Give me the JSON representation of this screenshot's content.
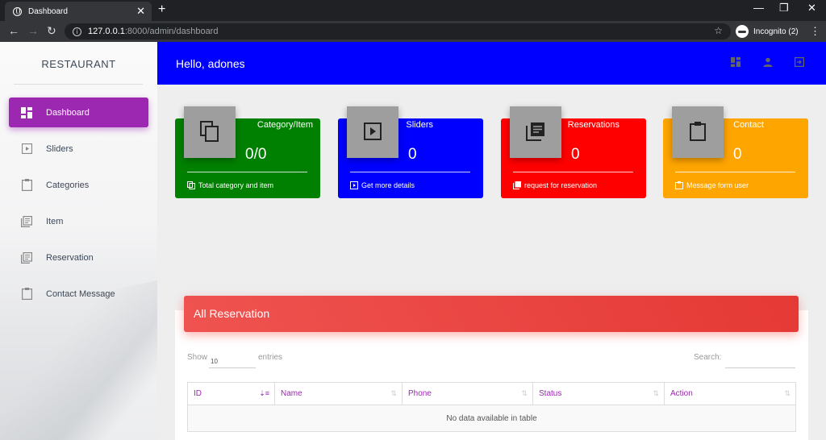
{
  "browser": {
    "tab_title": "Dashboard",
    "url_host": "127.0.0.1",
    "url_path": ":8000/admin/dashboard",
    "incognito_label": "Incognito (2)"
  },
  "sidebar": {
    "brand": "RESTAURANT",
    "items": [
      {
        "label": "Dashboard",
        "icon": "dashboard-icon"
      },
      {
        "label": "Sliders",
        "icon": "slideshow-icon"
      },
      {
        "label": "Categories",
        "icon": "clipboard-icon"
      },
      {
        "label": "Item",
        "icon": "library-books-icon"
      },
      {
        "label": "Reservation",
        "icon": "library-books-icon"
      },
      {
        "label": "Contact Message",
        "icon": "clipboard-icon"
      }
    ]
  },
  "header": {
    "greeting": "Hello, adones"
  },
  "cards": [
    {
      "title": "Category/Item",
      "value": "0/0",
      "footer": "Total category and item",
      "color": "#008000"
    },
    {
      "title": "Sliders",
      "value": "0",
      "footer": "Get more details",
      "color": "#0000ff"
    },
    {
      "title": "Reservations",
      "value": "0",
      "footer": "request for reservation",
      "color": "#ff0000"
    },
    {
      "title": "Contact",
      "value": "0",
      "footer": "Message form user",
      "color": "#ffa500"
    }
  ],
  "reservations": {
    "title": "All Reservation",
    "show_label": "Show",
    "page_size": "10",
    "entries_label": "entries",
    "search_label": "Search:",
    "columns": [
      "ID",
      "Name",
      "Phone",
      "Status",
      "Action"
    ],
    "empty_text": "No data available in table"
  },
  "colors": {
    "accent": "#9c27b0",
    "topbar": "#0000ff",
    "panel_header": "#e53935"
  }
}
